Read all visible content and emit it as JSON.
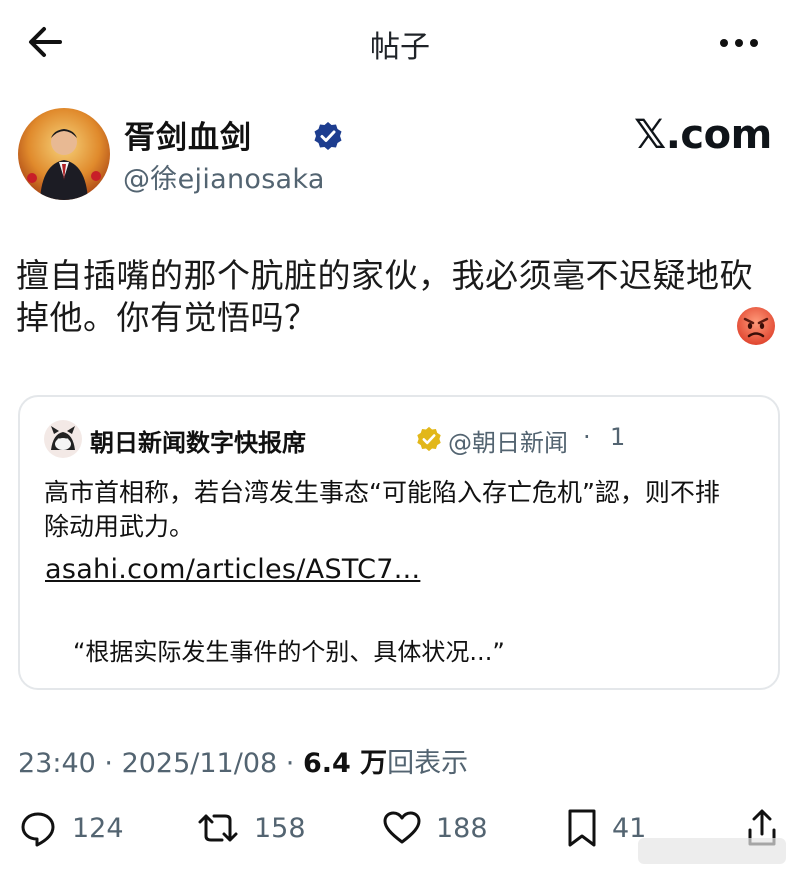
{
  "header": {
    "title": "帖子"
  },
  "author": {
    "name": "胥剑血剑",
    "handle": "@徐ejianosaka",
    "source": "𝕏.com"
  },
  "post": {
    "text": "擅自插嘴的那个肮脏的家伙，我必须毫不迟疑地砍掉他。你有觉悟吗？",
    "emoji": "angry-face"
  },
  "quote": {
    "name": "朝日新闻数字快报席",
    "handle": "@朝日新闻",
    "separator": "·",
    "time": "1",
    "text": "高市首相称，若台湾发生事态“可能陷入存亡危机”認，则不排除动用武力。",
    "link": "asahi.com/articles/ASTC7...",
    "excerpt": "“根据实际发生事件的个别、具体状况...”"
  },
  "meta": {
    "time": "23:40",
    "sep1": " · ",
    "date": "2025/11/08",
    "sep2": " · ",
    "views_value": "6.4 万",
    "views_label": "回表示"
  },
  "actions": {
    "replies": "124",
    "reposts": "158",
    "likes": "188",
    "bookmarks": "41"
  },
  "colors": {
    "text": "#0f1419",
    "secondary": "#536471",
    "verified_blue": "#1d9bf0",
    "gold_badge": "#e2b719",
    "border": "#e4e7ea"
  }
}
